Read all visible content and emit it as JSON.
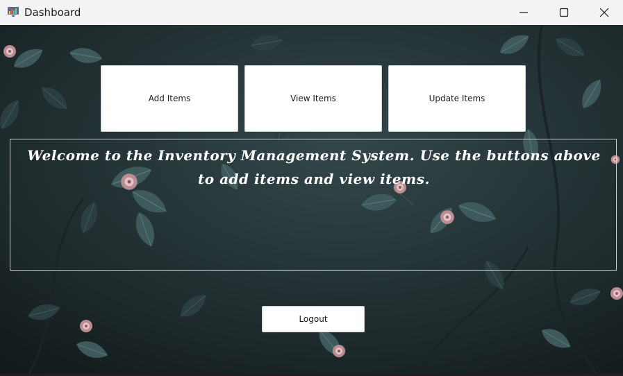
{
  "window": {
    "title": "Dashboard",
    "icon": "dashboard-app-icon",
    "controls": [
      "minimize-icon",
      "maximize-icon",
      "close-icon"
    ]
  },
  "buttons": {
    "add": "Add Items",
    "view": "View Items",
    "update": "Update Items",
    "logout": "Logout"
  },
  "welcome": {
    "text": "Welcome to the Inventory Management System. Use the buttons above to add items and view items."
  },
  "colors": {
    "background": "#1b2527",
    "leaf": "#3f5a5c",
    "flower": "#c9a7a9",
    "text": "#ffffff",
    "titlebar": "#f3f3f3"
  }
}
